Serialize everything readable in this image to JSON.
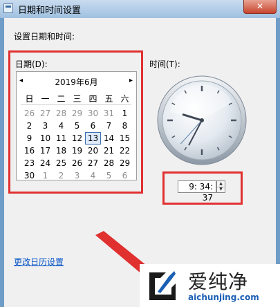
{
  "window": {
    "title": "日期和时间设置",
    "close_label": "✕"
  },
  "section_label": "设置日期和时间:",
  "date_label": "日期(D):",
  "time_label": "时间(T):",
  "calendar": {
    "month_label": "2019年6月",
    "prev_icon": "◂",
    "next_icon": "▸",
    "weekdays": [
      "日",
      "一",
      "二",
      "三",
      "四",
      "五",
      "六"
    ],
    "weeks": [
      [
        {
          "d": "26",
          "o": true
        },
        {
          "d": "27",
          "o": true
        },
        {
          "d": "28",
          "o": true
        },
        {
          "d": "29",
          "o": true
        },
        {
          "d": "30",
          "o": true
        },
        {
          "d": "31",
          "o": true
        },
        {
          "d": "1"
        }
      ],
      [
        {
          "d": "2"
        },
        {
          "d": "3"
        },
        {
          "d": "4"
        },
        {
          "d": "5"
        },
        {
          "d": "6"
        },
        {
          "d": "7"
        },
        {
          "d": "8"
        }
      ],
      [
        {
          "d": "9"
        },
        {
          "d": "10"
        },
        {
          "d": "11"
        },
        {
          "d": "12"
        },
        {
          "d": "13",
          "today": true
        },
        {
          "d": "14"
        },
        {
          "d": "15"
        }
      ],
      [
        {
          "d": "16"
        },
        {
          "d": "17"
        },
        {
          "d": "18"
        },
        {
          "d": "19"
        },
        {
          "d": "20"
        },
        {
          "d": "21"
        },
        {
          "d": "22"
        }
      ],
      [
        {
          "d": "23"
        },
        {
          "d": "24"
        },
        {
          "d": "25"
        },
        {
          "d": "26"
        },
        {
          "d": "27"
        },
        {
          "d": "28"
        },
        {
          "d": "29"
        }
      ],
      [
        {
          "d": "30"
        },
        {
          "d": "1",
          "o": true
        },
        {
          "d": "2",
          "o": true
        },
        {
          "d": "3",
          "o": true
        },
        {
          "d": "4",
          "o": true
        },
        {
          "d": "5",
          "o": true
        },
        {
          "d": "6",
          "o": true
        }
      ]
    ]
  },
  "clock": {
    "hour": 9,
    "minute": 34,
    "second": 37
  },
  "time_value": "9: 34: 37",
  "change_calendar_link": "更改日历设置",
  "watermark": {
    "text": "爱纯净",
    "url": "aichunjing.com"
  },
  "colors": {
    "highlight": "#e03030",
    "link": "#0b57c9",
    "titlebar": "#9fc0e0"
  }
}
